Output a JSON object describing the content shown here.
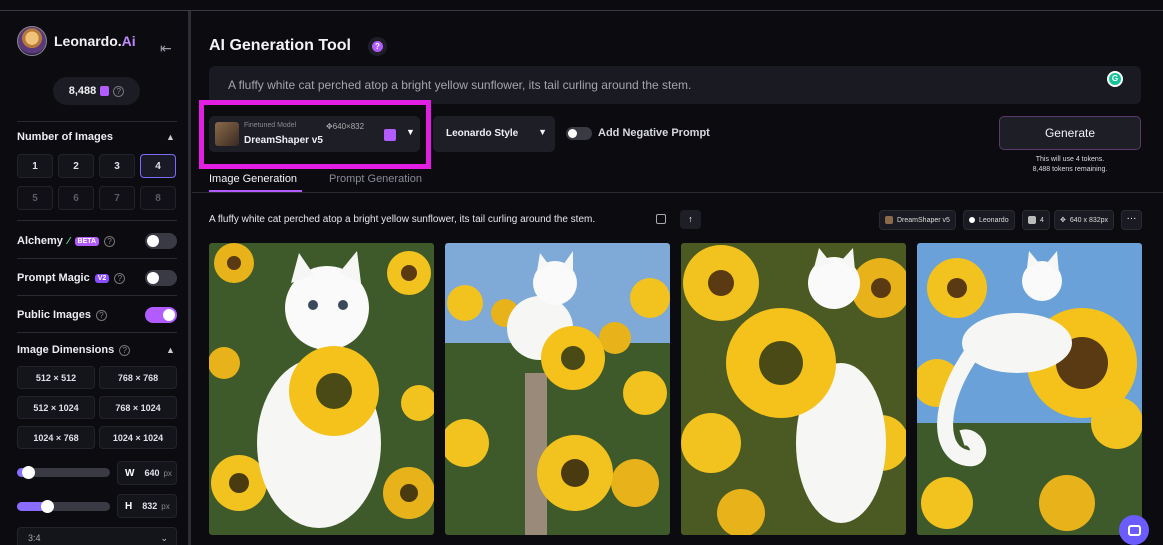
{
  "app": {
    "name_main": "Leonardo.",
    "name_ai": "Ai",
    "token_count": "8,488"
  },
  "sidebar": {
    "num_images_label": "Number of Images",
    "num_buttons": [
      "1",
      "2",
      "3",
      "4",
      "5",
      "6",
      "7",
      "8"
    ],
    "selected_num": "4",
    "alchemy_label": "Alchemy",
    "alchemy_badge": "BETA",
    "alchemy_on": false,
    "prompt_magic_label": "Prompt Magic",
    "prompt_magic_badge": "V2",
    "prompt_magic_on": false,
    "public_images_label": "Public Images",
    "public_images_on": true,
    "image_dimensions_label": "Image Dimensions",
    "dimensions": [
      "512 × 512",
      "768 × 768",
      "512 × 1024",
      "768 × 1024",
      "1024 × 768",
      "1024 × 1024"
    ],
    "width_key": "W",
    "width_value": "640",
    "height_key": "H",
    "height_value": "832",
    "unit": "px",
    "width_slider_fraction": 0.12,
    "height_slider_fraction": 0.32,
    "aspect_ratio": "3:4"
  },
  "main": {
    "title": "AI Generation Tool",
    "prompt_text": "A fluffy white cat perched atop a bright yellow sunflower, its tail curling around the stem.",
    "grammarly_icon": "G",
    "model": {
      "kicker": "Finetuned Model",
      "name": "DreamShaper v5",
      "dims": "640×832"
    },
    "style": "Leonardo Style",
    "negative_prompt_label": "Add Negative Prompt",
    "negative_prompt_on": false,
    "generate_label": "Generate",
    "generate_note_1": "This will use 4 tokens.",
    "generate_note_2": "8,488 tokens remaining.",
    "tabs": [
      "Image Generation",
      "Prompt Generation"
    ],
    "active_tab": "Image Generation"
  },
  "result": {
    "prompt": "A fluffy white cat perched atop a bright yellow sunflower, its tail curling around the stem.",
    "chips": {
      "model": "DreamShaper v5",
      "style": "Leonardo",
      "count": "4",
      "size": "640 x 832px"
    },
    "more": "···",
    "image_count": 4
  },
  "colors": {
    "accent": "#b25cff",
    "highlight_box": "#e31ee3",
    "background": "#0b0b10",
    "panel": "#1e1e27"
  }
}
